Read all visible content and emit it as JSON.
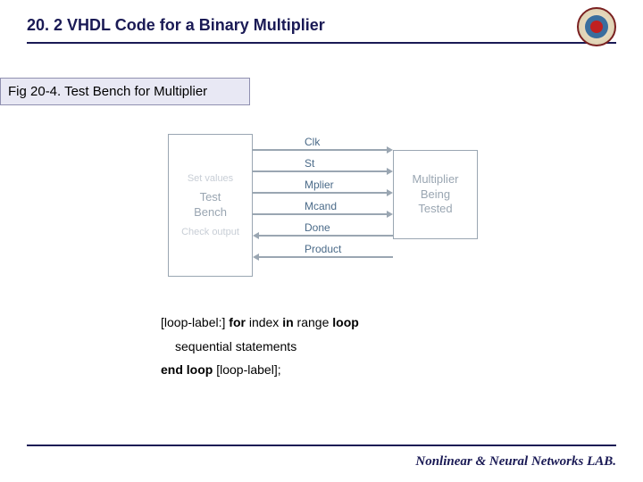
{
  "header": {
    "title": "20. 2 VHDL Code for a Binary Multiplier"
  },
  "caption": "Fig 20-4. Test Bench for Multiplier",
  "diagram": {
    "left_box": {
      "faded_top": "Set values",
      "line1": "Test",
      "line2": "Bench",
      "faded_bot": "Check output"
    },
    "right_box": {
      "line1": "Multiplier",
      "line2": "Being",
      "line3": "Tested"
    },
    "signals": [
      {
        "label": "Clk",
        "dir": "right"
      },
      {
        "label": "St",
        "dir": "right"
      },
      {
        "label": "Mplier",
        "dir": "right"
      },
      {
        "label": "Mcand",
        "dir": "right"
      },
      {
        "label": "Done",
        "dir": "left"
      },
      {
        "label": "Product",
        "dir": "left"
      }
    ]
  },
  "syntax": {
    "line1_a": "[loop-label:] ",
    "line1_for": "for",
    "line1_b": " index ",
    "line1_in": "in",
    "line1_c": " range ",
    "line1_loop": "loop",
    "line2": "sequential statements",
    "line3_end": "end loop",
    "line3_b": " [loop-label];"
  },
  "footer": "Nonlinear & Neural Networks LAB."
}
